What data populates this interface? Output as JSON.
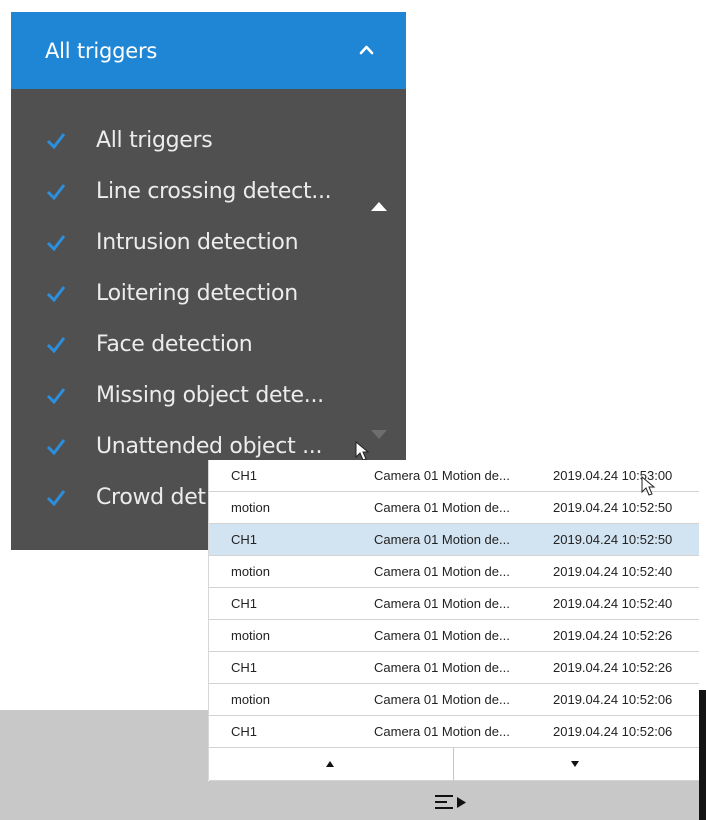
{
  "trigger_filter": {
    "selected_label": "All triggers",
    "items": [
      {
        "label": "All triggers",
        "checked": true
      },
      {
        "label": "Line crossing detect...",
        "checked": true
      },
      {
        "label": "Intrusion detection",
        "checked": true
      },
      {
        "label": "Loitering detection",
        "checked": true
      },
      {
        "label": "Face detection",
        "checked": true
      },
      {
        "label": "Missing object dete...",
        "checked": true
      },
      {
        "label": "Unattended object ...",
        "checked": true
      },
      {
        "label": "Crowd det",
        "checked": true
      }
    ]
  },
  "event_table": {
    "rows": [
      {
        "source": "CH1",
        "event": "Camera 01 Motion de...",
        "time": "2019.04.24 10:53:00"
      },
      {
        "source": "motion",
        "event": "Camera 01 Motion de...",
        "time": "2019.04.24 10:52:50"
      },
      {
        "source": "CH1",
        "event": "Camera 01 Motion de...",
        "time": "2019.04.24 10:52:50",
        "selected": true
      },
      {
        "source": "motion",
        "event": "Camera 01 Motion de...",
        "time": "2019.04.24 10:52:40"
      },
      {
        "source": "CH1",
        "event": "Camera 01 Motion de...",
        "time": "2019.04.24 10:52:40"
      },
      {
        "source": "motion",
        "event": "Camera 01 Motion de...",
        "time": "2019.04.24 10:52:26"
      },
      {
        "source": "CH1",
        "event": "Camera 01 Motion de...",
        "time": "2019.04.24 10:52:26"
      },
      {
        "source": "motion",
        "event": "Camera 01 Motion de...",
        "time": "2019.04.24 10:52:06"
      },
      {
        "source": "CH1",
        "event": "Camera 01 Motion de...",
        "time": "2019.04.24 10:52:06"
      }
    ]
  },
  "icons": {
    "header": "chevron-up-icon",
    "check": "checkmark-icon",
    "pager_prev": "triangle-up-icon",
    "pager_next": "triangle-down-icon",
    "footer": "playlist-play-icon"
  },
  "colors": {
    "header_bg": "#1f86d6",
    "panel_bg": "#505050",
    "check": "#2c8fdd",
    "selected_row": "#d2e3f1"
  }
}
